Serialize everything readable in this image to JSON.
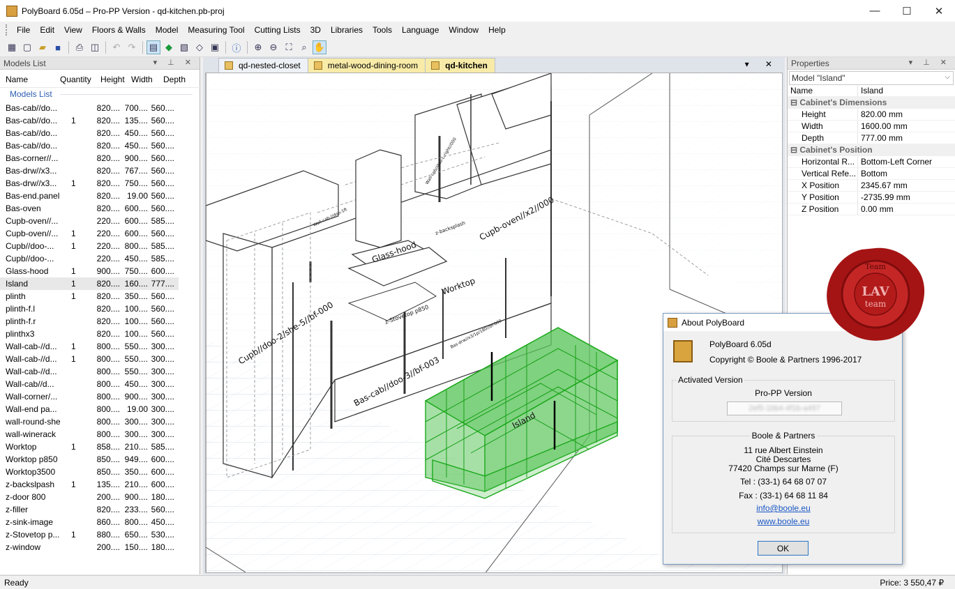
{
  "window": {
    "title": "PolyBoard 6.05d – Pro-PP Version - qd-kitchen.pb-proj",
    "minimize": "—",
    "maximize": "☐",
    "close": "✕"
  },
  "menu": [
    "File",
    "Edit",
    "View",
    "Floors & Walls",
    "Model",
    "Measuring Tool",
    "Cutting Lists",
    "3D",
    "Libraries",
    "Tools",
    "Language",
    "Window",
    "Help"
  ],
  "models_panel": {
    "title": "Models List",
    "columns": [
      "Name",
      "Quantity",
      "Height",
      "Width",
      "Depth"
    ],
    "group": "Models List",
    "rows": [
      {
        "name": "Bas-cab//do...",
        "qty": "",
        "h": "820....",
        "w": "700....",
        "d": "560...."
      },
      {
        "name": "Bas-cab//do...",
        "qty": "1",
        "h": "820....",
        "w": "135....",
        "d": "560...."
      },
      {
        "name": "Bas-cab//do...",
        "qty": "",
        "h": "820....",
        "w": "450....",
        "d": "560...."
      },
      {
        "name": "Bas-cab//do...",
        "qty": "",
        "h": "820....",
        "w": "450....",
        "d": "560...."
      },
      {
        "name": "Bas-corner//...",
        "qty": "",
        "h": "820....",
        "w": "900....",
        "d": "560...."
      },
      {
        "name": "Bas-drw//x3...",
        "qty": "",
        "h": "820....",
        "w": "767....",
        "d": "560...."
      },
      {
        "name": "Bas-drw//x3...",
        "qty": "1",
        "h": "820....",
        "w": "750....",
        "d": "560...."
      },
      {
        "name": "Bas-end.panel",
        "qty": "",
        "h": "820....",
        "w": "19.00",
        "d": "560...."
      },
      {
        "name": "Bas-oven",
        "qty": "",
        "h": "820....",
        "w": "600....",
        "d": "560...."
      },
      {
        "name": "Cupb-oven//...",
        "qty": "",
        "h": "220....",
        "w": "600....",
        "d": "585...."
      },
      {
        "name": "Cupb-oven//...",
        "qty": "1",
        "h": "220....",
        "w": "600....",
        "d": "560...."
      },
      {
        "name": "Cupb//doo-...",
        "qty": "1",
        "h": "220....",
        "w": "800....",
        "d": "585...."
      },
      {
        "name": "Cupb//doo-...",
        "qty": "",
        "h": "220....",
        "w": "450....",
        "d": "585...."
      },
      {
        "name": "Glass-hood",
        "qty": "1",
        "h": "900....",
        "w": "750....",
        "d": "600...."
      },
      {
        "name": "Island",
        "qty": "1",
        "h": "820....",
        "w": "160....",
        "d": "777...."
      },
      {
        "name": "plinth",
        "qty": "1",
        "h": "820....",
        "w": "350....",
        "d": "560...."
      },
      {
        "name": "plinth-f.l",
        "qty": "",
        "h": "820....",
        "w": "100....",
        "d": "560...."
      },
      {
        "name": "plinth-f.r",
        "qty": "",
        "h": "820....",
        "w": "100....",
        "d": "560...."
      },
      {
        "name": "plinthx3",
        "qty": "",
        "h": "820....",
        "w": "100....",
        "d": "560...."
      },
      {
        "name": "Wall-cab-//d...",
        "qty": "1",
        "h": "800....",
        "w": "550....",
        "d": "300...."
      },
      {
        "name": "Wall-cab-//d...",
        "qty": "1",
        "h": "800....",
        "w": "550....",
        "d": "300...."
      },
      {
        "name": "Wall-cab-//d...",
        "qty": "",
        "h": "800....",
        "w": "550....",
        "d": "300...."
      },
      {
        "name": "Wall-cab//d...",
        "qty": "",
        "h": "800....",
        "w": "450....",
        "d": "300...."
      },
      {
        "name": "Wall-corner/...",
        "qty": "",
        "h": "800....",
        "w": "900....",
        "d": "300...."
      },
      {
        "name": "Wall-end pa...",
        "qty": "",
        "h": "800....",
        "w": "19.00",
        "d": "300...."
      },
      {
        "name": "wall-round-she",
        "qty": "",
        "h": "800....",
        "w": "300....",
        "d": "300...."
      },
      {
        "name": "wall-winerack",
        "qty": "",
        "h": "800....",
        "w": "300....",
        "d": "300...."
      },
      {
        "name": "Worktop",
        "qty": "1",
        "h": "858....",
        "w": "210....",
        "d": "585...."
      },
      {
        "name": "Worktop p850",
        "qty": "",
        "h": "850....",
        "w": "949....",
        "d": "600...."
      },
      {
        "name": "Worktop3500",
        "qty": "",
        "h": "850....",
        "w": "350....",
        "d": "600...."
      },
      {
        "name": "z-backslpash",
        "qty": "1",
        "h": "135....",
        "w": "210....",
        "d": "600...."
      },
      {
        "name": "z-door 800",
        "qty": "",
        "h": "200....",
        "w": "900....",
        "d": "180...."
      },
      {
        "name": "z-filler",
        "qty": "",
        "h": "820....",
        "w": "233....",
        "d": "560...."
      },
      {
        "name": "z-sink-image",
        "qty": "",
        "h": "860....",
        "w": "800....",
        "d": "450...."
      },
      {
        "name": "z-Stovetop p...",
        "qty": "1",
        "h": "880....",
        "w": "650....",
        "d": "530...."
      },
      {
        "name": "z-window",
        "qty": "",
        "h": "200....",
        "w": "150....",
        "d": "180...."
      }
    ],
    "selected_index": 14
  },
  "tabs": [
    "qd-nested-closet",
    "metal-wood-dining-room",
    "qd-kitchen"
  ],
  "viewport_labels": {
    "glass_hood": "Glass-hood",
    "worktop": "Worktop",
    "cupb_oven": "Cupb-oven//x2//000",
    "cupb_she": "Cupb//doo-2/she-5//bf-000",
    "bas_cab": "Bas-cab//doo-3//bf-003",
    "stovetop": "z-Stovetop p850",
    "island": "Island",
    "wall_cab": "Wall-cab//doo-L-right//000",
    "backsplash": "z-backsplash",
    "bas_drw": "Bas-drw//x3/1p/180//bf-000",
    "wall_cab2": "Wall-cab-//doo-1ft"
  },
  "properties": {
    "title": "Properties",
    "selector": "Model \"Island\"",
    "name_key": "Name",
    "name_val": "Island",
    "cat_dims": "Cabinet's Dimensions",
    "dims": [
      {
        "k": "Height",
        "v": "820.00 mm"
      },
      {
        "k": "Width",
        "v": "1600.00 mm"
      },
      {
        "k": "Depth",
        "v": "777.00 mm"
      }
    ],
    "cat_pos": "Cabinet's Position",
    "pos": [
      {
        "k": "Horizontal R...",
        "v": "Bottom-Left Corner"
      },
      {
        "k": "Vertical Refe...",
        "v": "Bottom"
      },
      {
        "k": "X Position",
        "v": "2345.67 mm"
      },
      {
        "k": "Y Position",
        "v": "-2735.99 mm"
      },
      {
        "k": "Z Position",
        "v": "0.00 mm"
      }
    ]
  },
  "about": {
    "title": "About PolyBoard",
    "version": "PolyBoard 6.05d",
    "copyright": "Copyright © Boole & Partners 1996-2017",
    "activated_label": "Activated Version",
    "activated_value": "Pro-PP Version",
    "serial": "2ef5-1bb4-4f1b-a497",
    "company_label": "Boole & Partners",
    "address1": "11 rue Albert Einstein",
    "address2": "Cité Descartes",
    "address3": "77420 Champs sur Marne (F)",
    "tel": "Tel : (33-1) 64 68 07 07",
    "fax": "Fax : (33-1) 64 68 11 84",
    "email": "info@boole.eu",
    "web": "www.boole.eu",
    "ok": "OK"
  },
  "seal": {
    "top": "Team",
    "middle": "LAV",
    "bottom": "team"
  },
  "status": {
    "left": "Ready",
    "price": "Price: 3 550,47 ₽"
  },
  "colors": {
    "accent": "#2d5fb3",
    "selection_green": "#22c022",
    "tab_active": "#f8eba8",
    "seal_red": "#a51414"
  }
}
